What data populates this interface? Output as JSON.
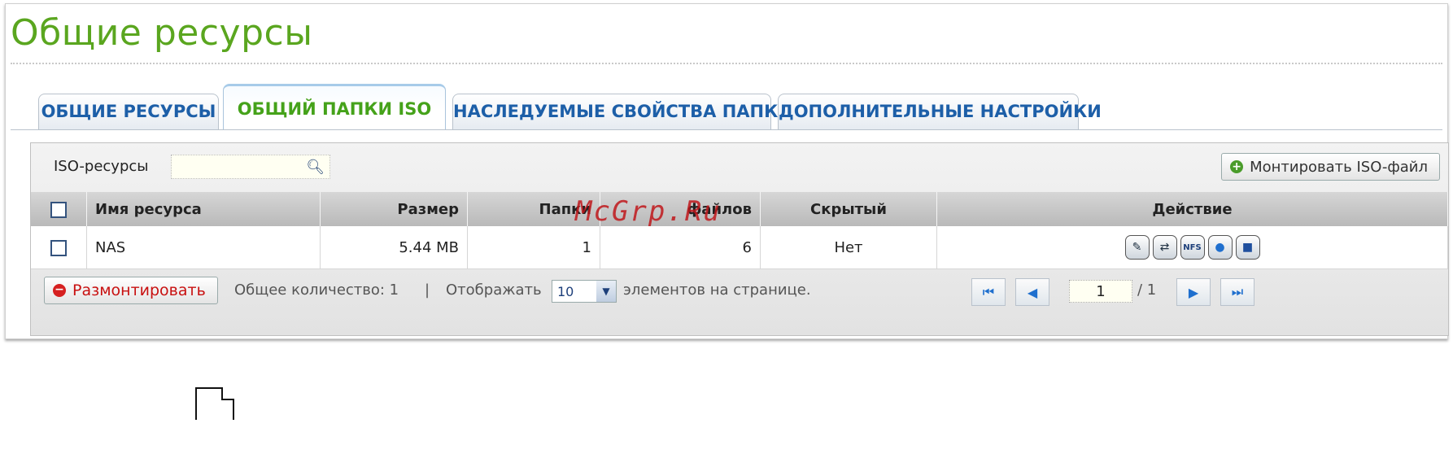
{
  "page": {
    "title": "Общие ресурсы"
  },
  "tabs": [
    {
      "label": "ОБЩИЕ РЕСУРСЫ",
      "active": false
    },
    {
      "label": "ОБЩИЙ ПАПКИ ISO",
      "active": true
    },
    {
      "label": "НАСЛЕДУЕМЫЕ СВОЙСТВА ПАПКИ",
      "active": false
    },
    {
      "label": "ДОПОЛНИТЕЛЬНЫЕ НАСТРОЙКИ",
      "active": false
    }
  ],
  "toolbar": {
    "search_label": "ISO-ресурсы",
    "search_value": "",
    "mount_button": "Монтировать ISO-файл"
  },
  "table": {
    "headers": [
      "Имя ресурса",
      "Размер",
      "Папки",
      "файлов",
      "Скрытый",
      "Действие"
    ],
    "rows": [
      {
        "name": "NAS",
        "size": "5.44 MB",
        "folders": "1",
        "files": "6",
        "hidden": "Нет"
      }
    ],
    "action_icons": [
      "edit-icon",
      "access-icon",
      "nfs-icon",
      "globe-icon",
      "monitor-icon"
    ],
    "action_nfs_label": "NFS"
  },
  "footer": {
    "unmount_button": "Размонтировать",
    "total_text": "Общее количество: 1",
    "separator": "|",
    "show_label": "Отображать",
    "per_page": "10",
    "per_page_suffix": "элементов на странице.",
    "current_page": "1",
    "total_pages": "/ 1"
  },
  "watermark": "McGrp.Ru",
  "colors": {
    "title_green": "#5aa61f",
    "tab_blue": "#1d5fa8",
    "danger_red": "#c81010"
  }
}
